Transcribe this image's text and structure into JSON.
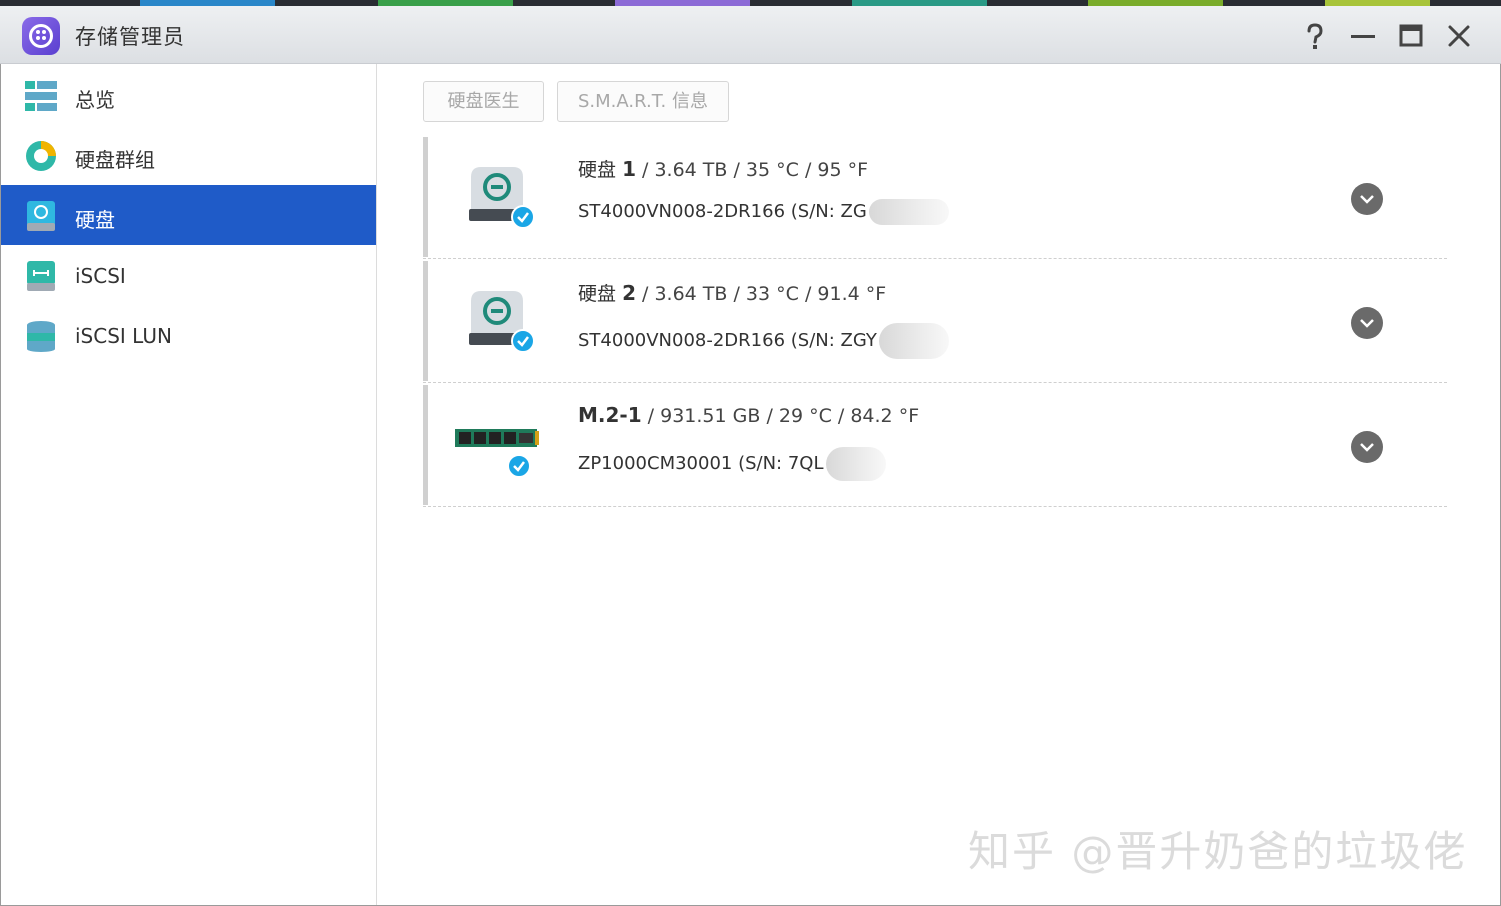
{
  "window": {
    "title": "存储管理员",
    "help_icon": "help-icon",
    "minimize_icon": "minimize-icon",
    "maximize_icon": "maximize-icon",
    "close_icon": "close-icon"
  },
  "sidebar": {
    "items": [
      {
        "label": "总览",
        "icon": "overview-icon",
        "active": false
      },
      {
        "label": "硬盘群组",
        "icon": "disk-group-icon",
        "active": false
      },
      {
        "label": "硬盘",
        "icon": "disk-icon",
        "active": true
      },
      {
        "label": "iSCSI",
        "icon": "iscsi-icon",
        "active": false
      },
      {
        "label": "iSCSI LUN",
        "icon": "iscsi-lun-icon",
        "active": false
      }
    ]
  },
  "toolbar": {
    "disk_doctor_label": "硬盘医生",
    "smart_info_label": "S.M.A.R.T. 信息"
  },
  "disks": [
    {
      "name": "硬盘",
      "number": "1",
      "meta": " / 3.64 TB / 35 °C / 95 °F",
      "model": "ST4000VN008-2DR166 (S/N: ZG",
      "type": "hdd"
    },
    {
      "name": "硬盘",
      "number": "2",
      "meta": " / 3.64 TB / 33 °C / 91.4 °F",
      "model": "ST4000VN008-2DR166 (S/N: ZGY",
      "type": "hdd"
    },
    {
      "name": "",
      "number": "M.2-1",
      "meta": " / 931.51 GB / 29 °C / 84.2 °F",
      "model": "ZP1000CM30001 (S/N: 7QL",
      "type": "m2"
    }
  ],
  "watermark": "知乎 @晋升奶爸的垃圾佬",
  "colors": {
    "accent": "#1f5bc8",
    "check": "#1aa6e6"
  }
}
